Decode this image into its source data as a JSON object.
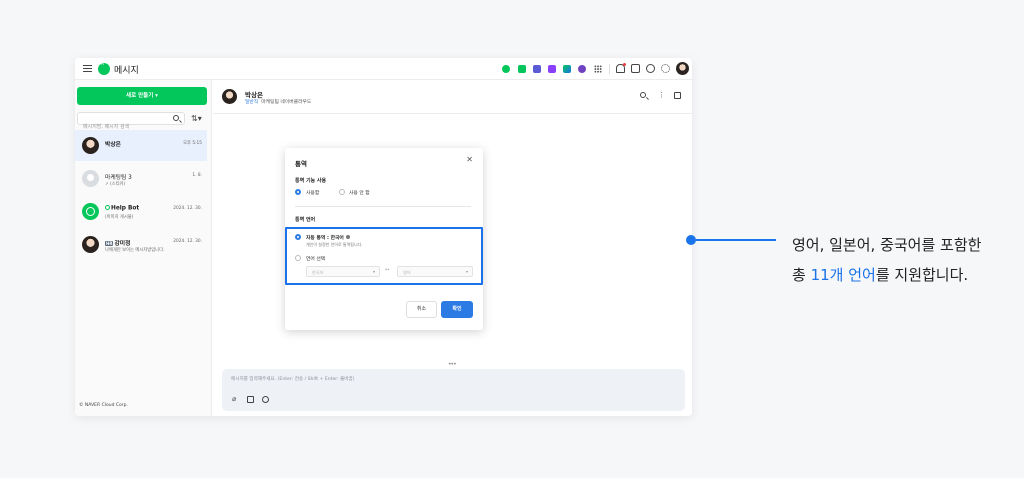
{
  "app": {
    "title": "메시지"
  },
  "toolbar": {
    "icons": [
      "talk-icon",
      "mail-icon",
      "calendar-icon",
      "note-icon",
      "drive-icon",
      "shield-icon",
      "apps-grid-icon",
      "bell-icon",
      "org-chart-icon",
      "help-icon",
      "settings-icon",
      "avatar"
    ],
    "icon_colors": [
      "#03c75a",
      "#03c75a",
      "#5b5bd6",
      "#8a3ffc",
      "#2c9f45",
      "#6f42c1"
    ]
  },
  "sidebar": {
    "new_button": "새로 만들기 ▾",
    "search_placeholder": "메시지방, 메시지 검색",
    "conversations": [
      {
        "name": "박상은",
        "sub": "",
        "time": "오후 5:15"
      },
      {
        "name": "마케팅팀 3",
        "sub": "(스티커)",
        "time": "1. 8."
      },
      {
        "name": "Help Bot",
        "sub": "(이미지 게시물)",
        "time": "2024. 12. 30."
      },
      {
        "name": "강미정",
        "dept": "HR",
        "sub": "나에게만 보이는 메시지방입니다.",
        "time": "2024. 12. 30."
      }
    ],
    "copyright": "© NAVER Cloud Corp."
  },
  "chat": {
    "name": "박상은",
    "role": "일반직",
    "org": "마케팅팀 네이버클라우드",
    "composer_placeholder": "메시지를 입력해주세요. (Enter: 전송 / Shift + Enter: 줄바꿈)"
  },
  "modal": {
    "title": "통역",
    "use_section": "통역 기능 사용",
    "use_options": [
      "사용함",
      "사용 안 함"
    ],
    "lang_section": "통역 언어",
    "auto_label": "자동 통역 : 한국어",
    "auto_desc": "개인이 설정한 언어로 통역됩니다.",
    "manual_label": "언어 선택",
    "source_lang": "한국어",
    "target_lang": "영어",
    "swap_symbol": "↔",
    "cancel": "취소",
    "confirm": "확인"
  },
  "callout": {
    "line1": "영어, 일본어, 중국어를 포함한",
    "line2_pre": "총 ",
    "line2_accent": "11개 언어",
    "line2_post": "를 지원합니다."
  }
}
